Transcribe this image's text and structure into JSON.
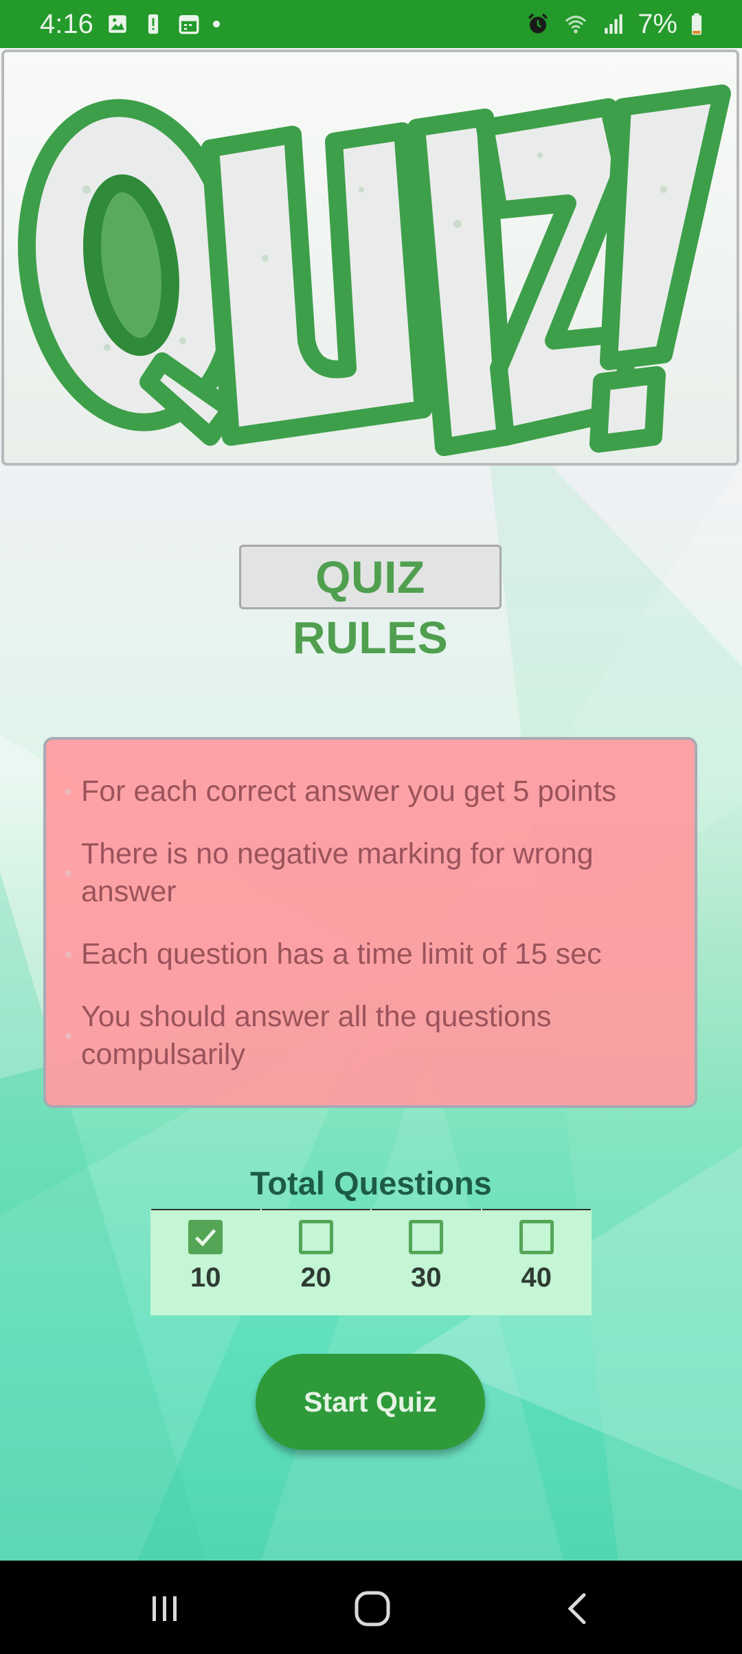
{
  "status_bar": {
    "time": "4:16",
    "battery": "7%",
    "left_icons": [
      "image-icon",
      "alert-icon",
      "calendar-icon",
      "dot-icon"
    ],
    "right_icons": [
      "alarm-icon",
      "wifi-icon",
      "signal-icon",
      "battery-icon"
    ],
    "color": "#239a2a"
  },
  "banner": {
    "image": "quiz-logo"
  },
  "page": {
    "title": "QUIZ RULES"
  },
  "rules": [
    {
      "text": "For each correct answer you get 5 points"
    },
    {
      "text": "There is no negative marking for wrong answer"
    },
    {
      "text": "Each question has a time limit of 15 sec"
    },
    {
      "text": "You should answer all the questions compulsarily"
    }
  ],
  "total_questions": {
    "label": "Total Questions",
    "options": [
      {
        "value": "10",
        "checked": true
      },
      {
        "value": "20",
        "checked": false
      },
      {
        "value": "30",
        "checked": false
      },
      {
        "value": "40",
        "checked": false
      }
    ]
  },
  "start_button": {
    "label": "Start Quiz"
  },
  "nav_bar": {
    "buttons": [
      "recent-apps-icon",
      "home-icon",
      "back-icon"
    ]
  },
  "colors": {
    "accent": "#4f9f4f",
    "rules_bg": "#ff9ba0",
    "rules_text": "#9b535b",
    "button": "#2e9a3a"
  }
}
